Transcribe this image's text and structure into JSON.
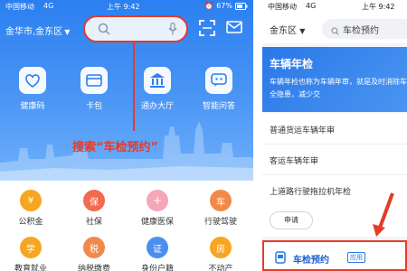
{
  "left": {
    "status": {
      "carrier": "中国移动",
      "network": "4G",
      "time": "上午 9:42",
      "battery": "67%"
    },
    "city": "金华市,金东区",
    "quick_actions": [
      {
        "label": "健康码",
        "icon": "health-code-icon"
      },
      {
        "label": "卡包",
        "icon": "card-wallet-icon"
      },
      {
        "label": "通办大厅",
        "icon": "hall-icon"
      },
      {
        "label": "智能问答",
        "icon": "chat-bot-icon"
      }
    ],
    "annotation": "搜索“车检预约”",
    "services_row1": [
      "公积金",
      "社保",
      "健康医保",
      "行驶驾驶"
    ],
    "services_row2": [
      "教育就业",
      "纳税缴费",
      "身份户籍",
      "不动产"
    ]
  },
  "right": {
    "status": {
      "carrier": "中国移动",
      "network": "4G",
      "time": "上午 9:42"
    },
    "district": "金东区",
    "search_text": "车检预约",
    "banner_title": "车辆年检",
    "banner_desc": "车辆年检也称为车辆年审，就是及时消除车辆安全隐患，减少交",
    "items": [
      "普通货运车辆年审",
      "客运车辆年审",
      "上道路行驶拖拉机年检"
    ],
    "apply_label": "申请",
    "result_title": "车检预约",
    "result_tag": "应用"
  },
  "colors": {
    "primary": "#2b7ff0",
    "highlight": "#e63a2a"
  }
}
